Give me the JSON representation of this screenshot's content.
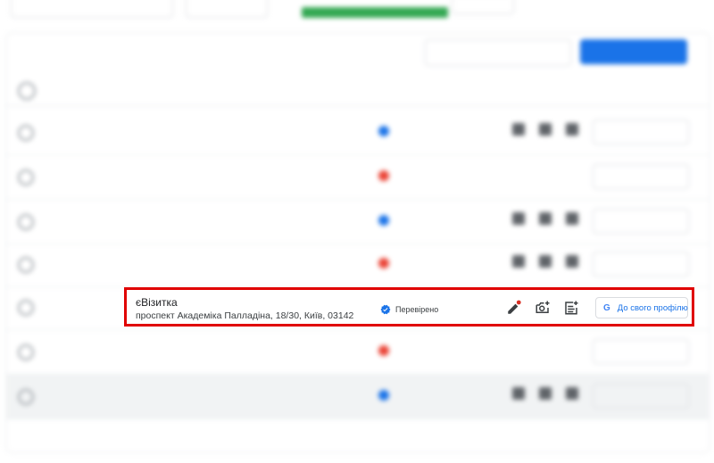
{
  "focused_row": {
    "name": "єВізитка",
    "address": "проспект Академіка Палладіна, 18/30, Київ, 03142",
    "status": "Перевірено",
    "profile_button": "До свого профілю",
    "icons": [
      "verified-badge-icon",
      "edit-icon",
      "add-photo-icon",
      "add-post-icon",
      "google-g-icon"
    ],
    "colors": {
      "highlight": "#e00000",
      "link": "#1a73e8",
      "badge": "#1a73e8"
    }
  }
}
